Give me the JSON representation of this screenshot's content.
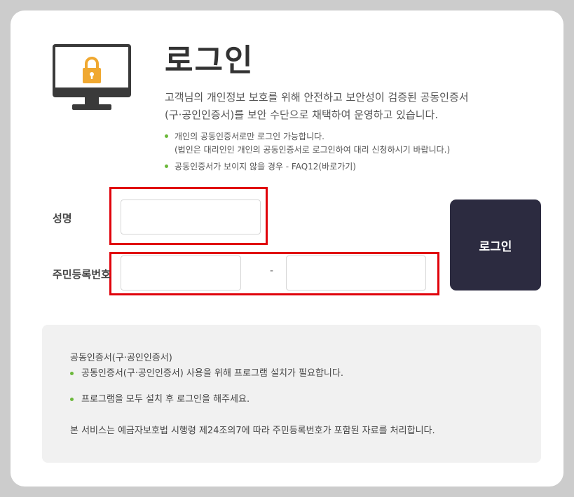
{
  "header": {
    "title": "로그인",
    "description_line1": "고객님의 개인정보 보호를 위해 안전하고 보안성이 검증된 공동인증서",
    "description_line2": "(구·공인인증서)를 보안 수단으로 채택하여 운영하고 있습니다.",
    "bullet1_line1": "개인의 공동인증서로만 로그인 가능합니다.",
    "bullet1_line2": "(법인은 대리인인 개인의 공동인증서로 로그인하여 대리 신청하시기 바랍니다.)",
    "bullet2": "공동인증서가 보이지 않을 경우 - FAQ12(바로가기)"
  },
  "form": {
    "name_label": "성명",
    "name_value": "",
    "rrn_label": "주민등록번호",
    "rrn_front_value": "",
    "rrn_separator": "-",
    "rrn_back_value": "",
    "login_button": "로그인"
  },
  "info": {
    "title": "공동인증서(구·공인인증서)",
    "items": [
      "공동인증서(구·공인인증서) 사용을 위해 프로그램 설치가 필요합니다.",
      "프로그램을 모두 설치 후 로그인을 해주세요."
    ],
    "note": "본 서비스는 예금자보호법 시행령 제24조의7에 따라 주민등록번호가 포함된 자료를 처리합니다."
  },
  "icons": {
    "monitor": "monitor-icon",
    "lock": "lock-icon"
  },
  "colors": {
    "accent_green": "#6bb83a",
    "button_dark": "#2c2b40",
    "highlight_red": "#e0000a",
    "lock_orange": "#f0a830"
  }
}
